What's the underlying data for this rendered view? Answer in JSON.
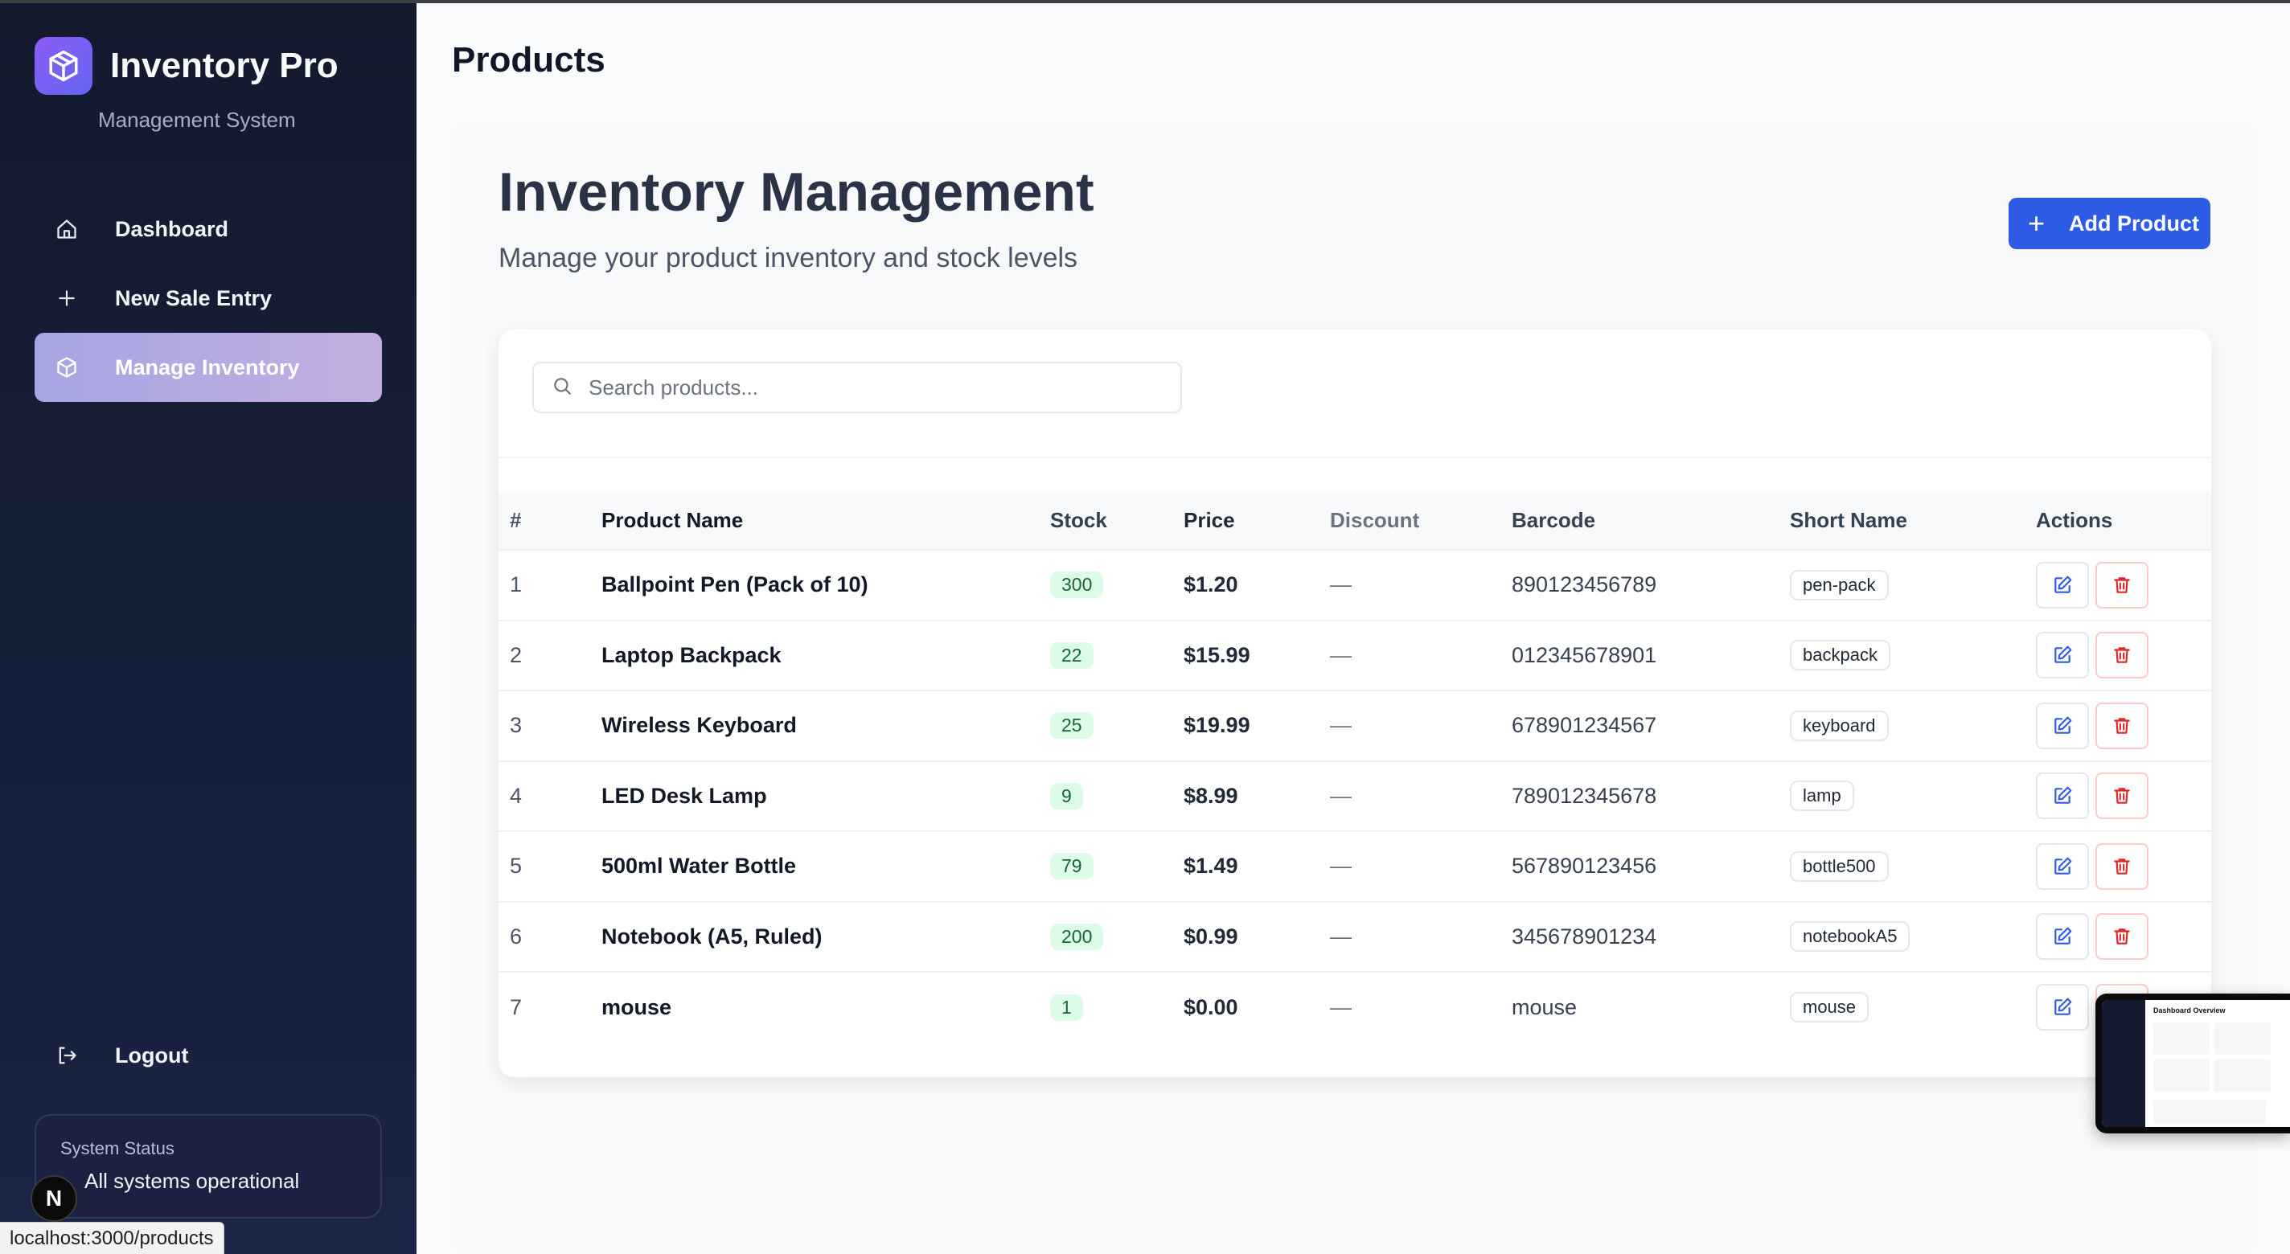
{
  "sidebar": {
    "brand_title": "Inventory Pro",
    "brand_subtitle": "Management System",
    "nav": [
      {
        "label": "Dashboard",
        "icon": "home-icon"
      },
      {
        "label": "New Sale Entry",
        "icon": "plus-icon"
      },
      {
        "label": "Manage Inventory",
        "icon": "box-icon",
        "active": true
      }
    ],
    "logout_label": "Logout",
    "status_label": "System Status",
    "status_text": "All systems operational"
  },
  "header": {
    "title": "Products"
  },
  "main": {
    "heading": "Inventory Management",
    "subheading": "Manage your product inventory and stock levels",
    "add_button_label": "Add Product",
    "search_placeholder": "Search products..."
  },
  "table": {
    "columns": [
      "#",
      "Product Name",
      "Stock",
      "Price",
      "Discount",
      "Barcode",
      "Short Name",
      "Actions"
    ],
    "rows": [
      {
        "num": "1",
        "name": "Ballpoint Pen (Pack of 10)",
        "stock": "300",
        "price": "$1.20",
        "discount": "—",
        "barcode": "890123456789",
        "short": "pen-pack"
      },
      {
        "num": "2",
        "name": "Laptop Backpack",
        "stock": "22",
        "price": "$15.99",
        "discount": "—",
        "barcode": "012345678901",
        "short": "backpack"
      },
      {
        "num": "3",
        "name": "Wireless Keyboard",
        "stock": "25",
        "price": "$19.99",
        "discount": "—",
        "barcode": "678901234567",
        "short": "keyboard"
      },
      {
        "num": "4",
        "name": "LED Desk Lamp",
        "stock": "9",
        "price": "$8.99",
        "discount": "—",
        "barcode": "789012345678",
        "short": "lamp"
      },
      {
        "num": "5",
        "name": "500ml Water Bottle",
        "stock": "79",
        "price": "$1.49",
        "discount": "—",
        "barcode": "567890123456",
        "short": "bottle500"
      },
      {
        "num": "6",
        "name": "Notebook (A5, Ruled)",
        "stock": "200",
        "price": "$0.99",
        "discount": "—",
        "barcode": "345678901234",
        "short": "notebookA5"
      },
      {
        "num": "7",
        "name": "mouse",
        "stock": "1",
        "price": "$0.00",
        "discount": "—",
        "barcode": "mouse",
        "short": "mouse"
      }
    ]
  },
  "dev": {
    "badge_letter": "N",
    "url_status": "localhost:3000/products"
  },
  "preview": {
    "title": "Dashboard Overview"
  },
  "colors": {
    "accent": "#2d5be3",
    "active_nav": "#b3abe1",
    "sidebar_bg": "#131a2e",
    "stock_badge": "#dcfce7",
    "delete": "#dc2626"
  }
}
